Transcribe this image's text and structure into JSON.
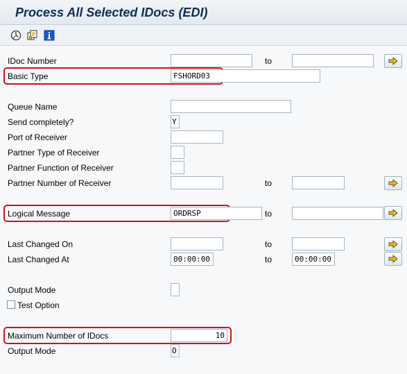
{
  "window": {
    "title": "Process All Selected IDocs (EDI)"
  },
  "toolbar": {
    "icons": [
      "execute-icon",
      "variant-icon",
      "info-icon"
    ]
  },
  "fields": {
    "idoc_number": {
      "label": "IDoc Number",
      "from": "",
      "to": ""
    },
    "basic_type": {
      "label": "Basic Type",
      "value": "FSHORD03"
    },
    "queue_name": {
      "label": "Queue Name",
      "value": ""
    },
    "send_completely": {
      "label": "Send completely?",
      "value": "Y"
    },
    "port_of_receiver": {
      "label": "Port of Receiver",
      "value": ""
    },
    "partner_type": {
      "label": "Partner Type of Receiver",
      "value": ""
    },
    "partner_function": {
      "label": "Partner Function of Receiver",
      "value": ""
    },
    "partner_number": {
      "label": "Partner Number of Receiver",
      "from": "",
      "to": ""
    },
    "logical_message": {
      "label": "Logical Message",
      "from": "ORDRSP",
      "to": ""
    },
    "last_changed_on": {
      "label": "Last Changed On",
      "from": "",
      "to": ""
    },
    "last_changed_at": {
      "label": "Last Changed At",
      "from": "00:00:00",
      "to": "00:00:00"
    },
    "output_mode_1": {
      "label": "Output Mode",
      "value": ""
    },
    "test_option": {
      "label": "Test Option",
      "checked": false
    },
    "max_idocs": {
      "label": "Maximum Number of IDocs",
      "value": "10"
    },
    "output_mode_2": {
      "label": "Output Mode",
      "value": "O"
    }
  },
  "range_to_label": "to",
  "colors": {
    "highlight": "#d0111b",
    "title": "#0d2f56",
    "arrow": "#f2c200"
  }
}
